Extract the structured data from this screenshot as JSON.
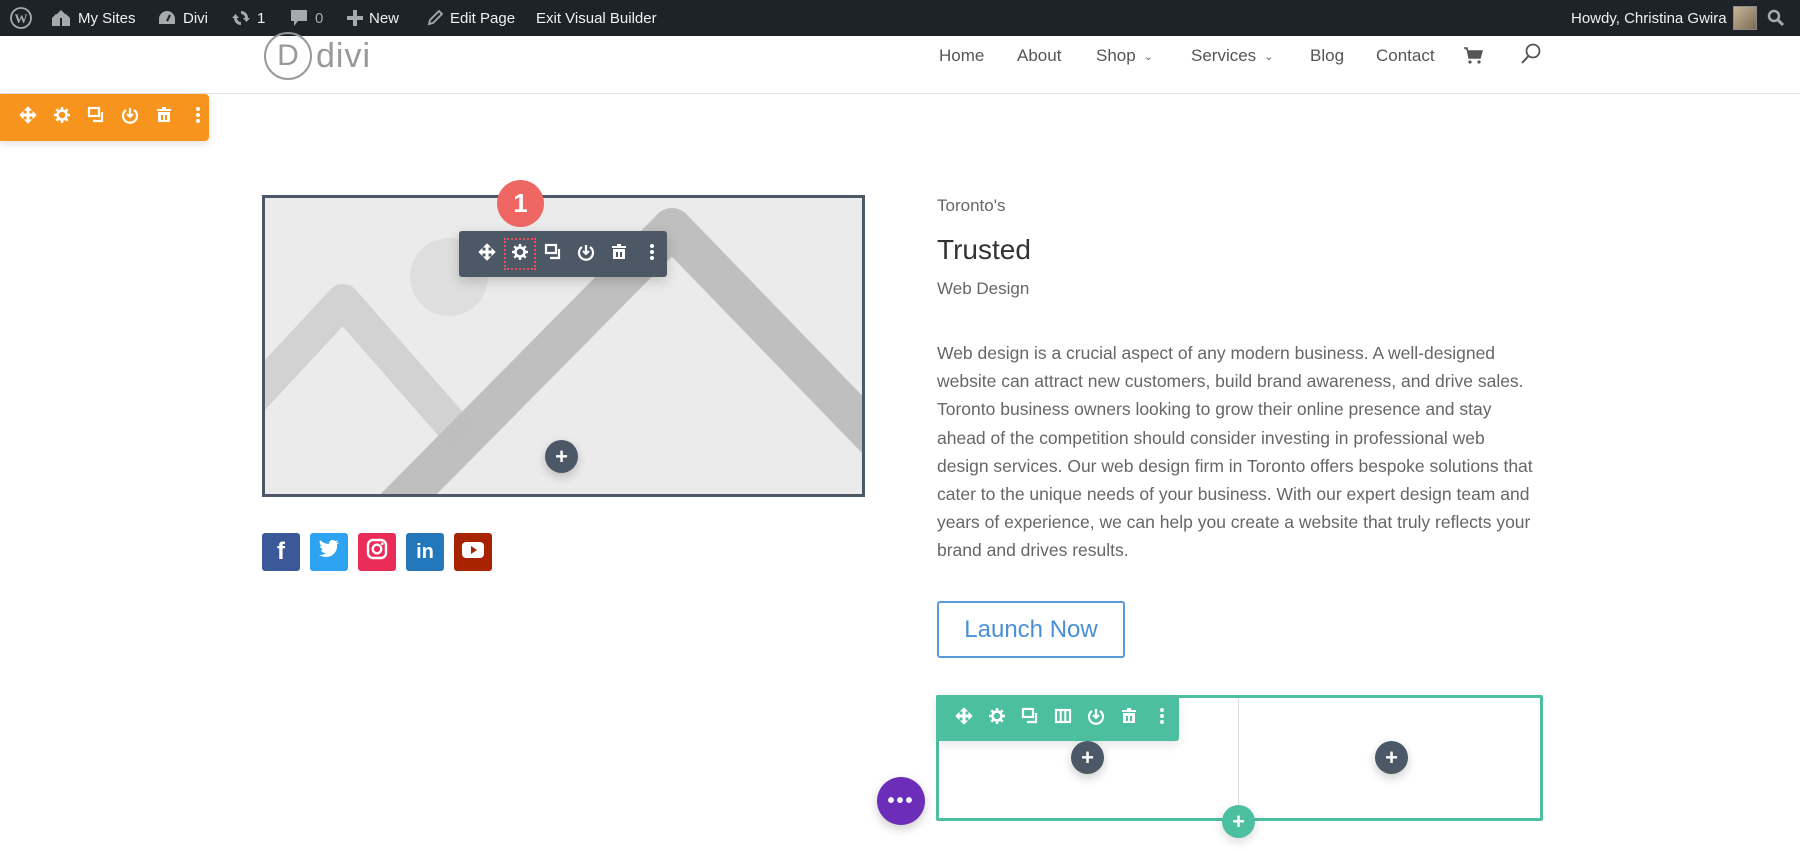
{
  "admin_bar": {
    "items": [
      {
        "icon": "wordpress-icon",
        "label": ""
      },
      {
        "icon": "my-sites-icon",
        "label": "My Sites"
      },
      {
        "icon": "dashboard-icon",
        "label": "Divi"
      },
      {
        "icon": "updates-icon",
        "label": "1"
      },
      {
        "icon": "comments-icon",
        "label": "0"
      },
      {
        "icon": "plus-icon",
        "label": "New"
      },
      {
        "icon": "pencil-icon",
        "label": "Edit Page"
      },
      {
        "icon": "",
        "label": "Exit Visual Builder"
      }
    ],
    "greeting": "Howdy, Christina Gwira",
    "search_icon": "search-icon"
  },
  "header": {
    "logo_letter": "D",
    "logo_text": "divi",
    "nav": [
      {
        "label": "Home",
        "has_dropdown": false
      },
      {
        "label": "About",
        "has_dropdown": false
      },
      {
        "label": "Shop",
        "has_dropdown": true
      },
      {
        "label": "Services",
        "has_dropdown": true
      },
      {
        "label": "Blog",
        "has_dropdown": false
      },
      {
        "label": "Contact",
        "has_dropdown": false
      }
    ],
    "cart_icon": "cart-icon",
    "search_icon": "search-icon"
  },
  "section_toolbar": {
    "color": "#f7941d",
    "buttons": [
      "move",
      "settings",
      "duplicate",
      "save-to-library",
      "delete",
      "more"
    ]
  },
  "module_toolbar": {
    "color": "#4c5866",
    "buttons": [
      "move",
      "settings",
      "duplicate",
      "save-to-library",
      "delete",
      "more"
    ],
    "highlighted": "settings"
  },
  "step_badge": {
    "label": "1",
    "color": "#ee6763"
  },
  "social": [
    {
      "network": "facebook",
      "glyph": "f",
      "color": "#3b5998"
    },
    {
      "network": "twitter",
      "glyph": "t",
      "color": "#2ea3f2"
    },
    {
      "network": "instagram",
      "glyph": "ig",
      "color": "#ea2c59"
    },
    {
      "network": "linkedin",
      "glyph": "in",
      "color": "#007bb6"
    },
    {
      "network": "youtube",
      "glyph": "▶",
      "color": "#a82400"
    }
  ],
  "content": {
    "pre_title": "Toronto's",
    "title": "Trusted",
    "subtitle": "Web Design",
    "paragraph_lines": [
      "Web design is a crucial aspect of any modern business. A well-designed",
      "website can attract new customers, build brand awareness, and drive sales.",
      "Toronto business owners looking to grow their online presence and stay",
      "ahead of the competition should consider investing in professional web",
      "design services. Our web design firm in Toronto offers bespoke solutions that",
      "cater to the unique needs of your business. With our expert design team and",
      "years of experience, we can help you create a website that truly reflects your",
      "brand and drives results."
    ],
    "button_label": "Launch Now"
  },
  "row_toolbar": {
    "color": "#4dbfa1",
    "buttons": [
      "move",
      "settings",
      "duplicate",
      "columns",
      "save-to-library",
      "delete",
      "more"
    ]
  },
  "add_buttons": {
    "plus": "+",
    "more": "•••"
  }
}
